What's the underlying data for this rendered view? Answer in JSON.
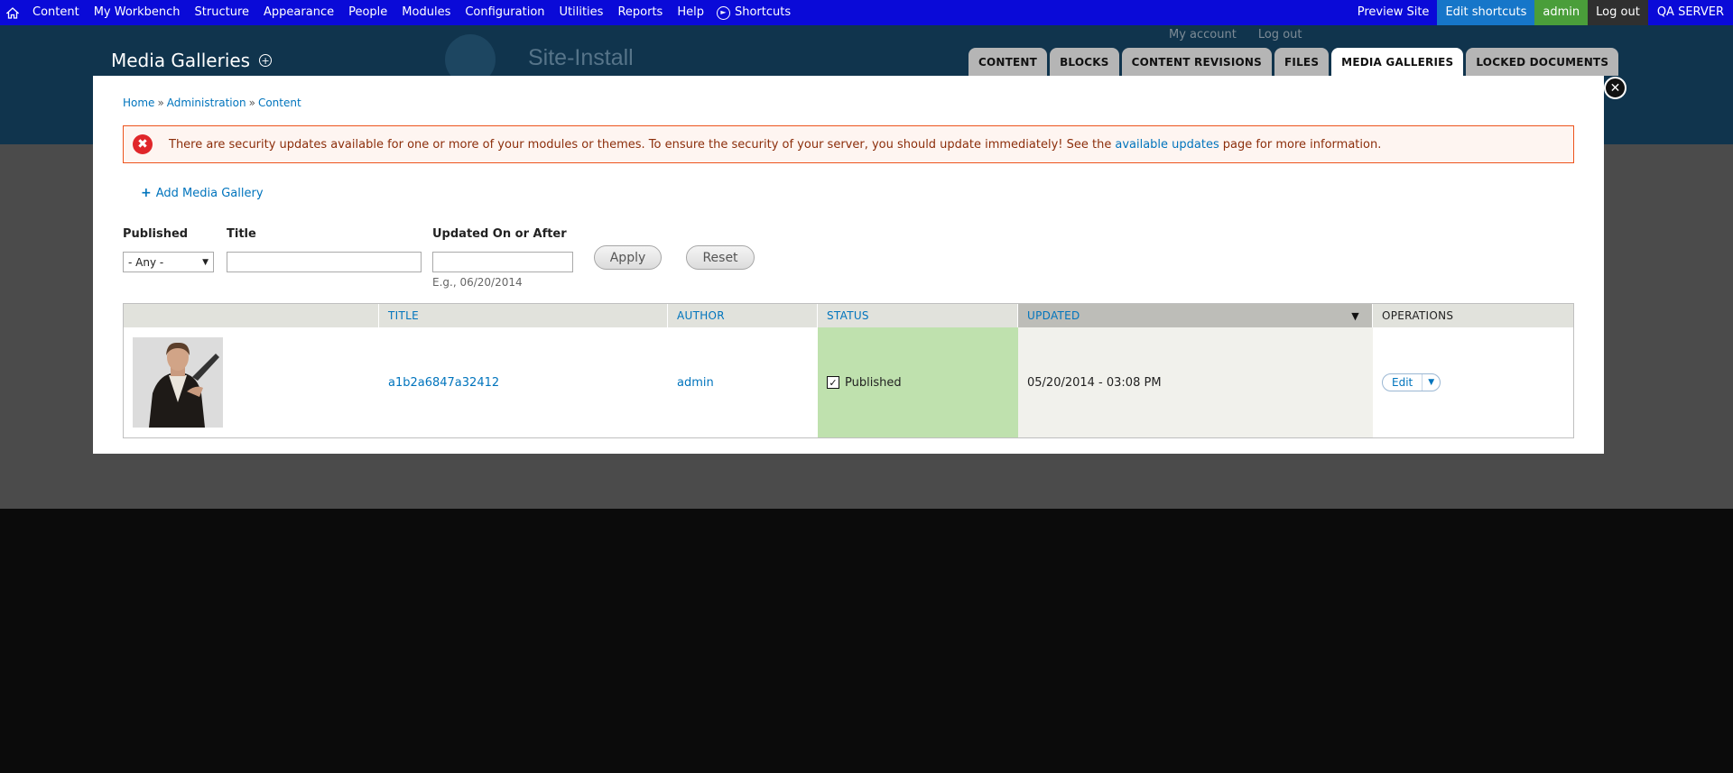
{
  "toolbar": {
    "menu": [
      "Content",
      "My Workbench",
      "Structure",
      "Appearance",
      "People",
      "Modules",
      "Configuration",
      "Utilities",
      "Reports",
      "Help"
    ],
    "shortcuts_label": "Shortcuts",
    "preview_site": "Preview Site",
    "edit_shortcuts": "Edit shortcuts",
    "user": "admin",
    "logout": "Log out",
    "server": "QA SERVER"
  },
  "header": {
    "my_account": "My account",
    "log_out": "Log out",
    "site_name": "Site-Install"
  },
  "overlay": {
    "title": "Media Galleries",
    "tabs": [
      {
        "label": "CONTENT",
        "active": false
      },
      {
        "label": "BLOCKS",
        "active": false
      },
      {
        "label": "CONTENT REVISIONS",
        "active": false
      },
      {
        "label": "FILES",
        "active": false
      },
      {
        "label": "MEDIA GALLERIES",
        "active": true
      },
      {
        "label": "LOCKED DOCUMENTS",
        "active": false
      }
    ]
  },
  "breadcrumb": {
    "home": "Home",
    "administration": "Administration",
    "content": "Content",
    "separator": "»"
  },
  "message": {
    "text_before": "There are security updates available for one or more of your modules or themes. To ensure the security of your server, you should update immediately! See the",
    "link": "available updates",
    "text_after": "page for more information."
  },
  "actions": {
    "add_media_gallery": "Add Media Gallery"
  },
  "filters": {
    "published_label": "Published",
    "published_value": "- Any -",
    "title_label": "Title",
    "title_value": "",
    "updated_label": "Updated On or After",
    "updated_value": "",
    "updated_hint": "E.g., 06/20/2014",
    "apply": "Apply",
    "reset": "Reset"
  },
  "table": {
    "headers": {
      "title": "TITLE",
      "author": "AUTHOR",
      "status": "STATUS",
      "updated": "UPDATED",
      "operations": "OPERATIONS"
    },
    "rows": [
      {
        "title": "a1b2a6847a32412",
        "author": "admin",
        "status": "Published",
        "updated": "05/20/2014 - 03:08 PM",
        "operation": "Edit"
      }
    ]
  }
}
